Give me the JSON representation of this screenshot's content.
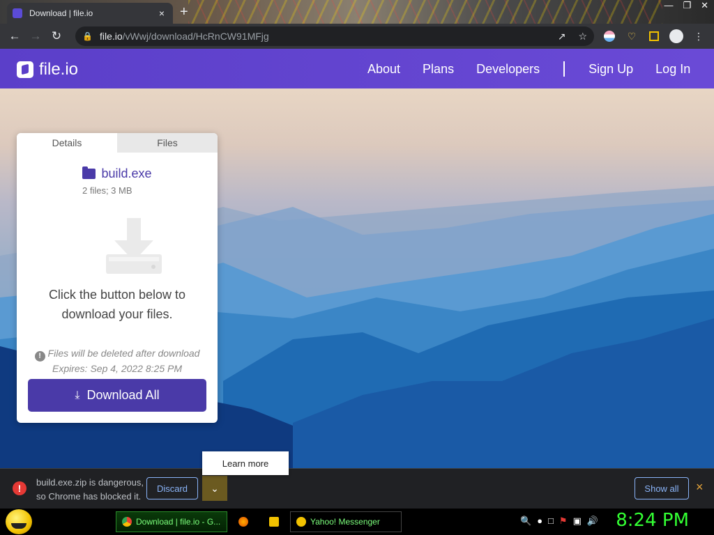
{
  "browser": {
    "tab_title": "Download | file.io",
    "url_host": "file.io",
    "url_path": "/vWwj/download/HcRnCW91MFjg",
    "new_tab": "+",
    "tab_close": "×"
  },
  "site": {
    "logo_text": "file.io",
    "nav": {
      "about": "About",
      "plans": "Plans",
      "developers": "Developers",
      "signup": "Sign Up",
      "login": "Log In"
    },
    "brand_color": "#5b3fc9"
  },
  "card": {
    "tabs": [
      "Details",
      "Files"
    ],
    "file_name": "build.exe",
    "file_meta": "2 files; 3 MB",
    "prompt": "Click the button below to download your files.",
    "warning": "Files will be deleted after download",
    "expires": "Expires: Sep 4, 2022 8:25 PM",
    "download_label": "Download All",
    "accent_color": "#4a3aa8"
  },
  "tooltip": {
    "text": "Learn more"
  },
  "download_bar": {
    "message_line1": "build.exe.zip is dangerous,",
    "message_line2": "so Chrome has blocked it.",
    "discard_label": "Discard",
    "show_all_label": "Show all",
    "close": "×"
  },
  "taskbar": {
    "task1": "Download | file.io - G...",
    "task2": "Yahoo! Messenger",
    "clock": "8:24 PM"
  }
}
